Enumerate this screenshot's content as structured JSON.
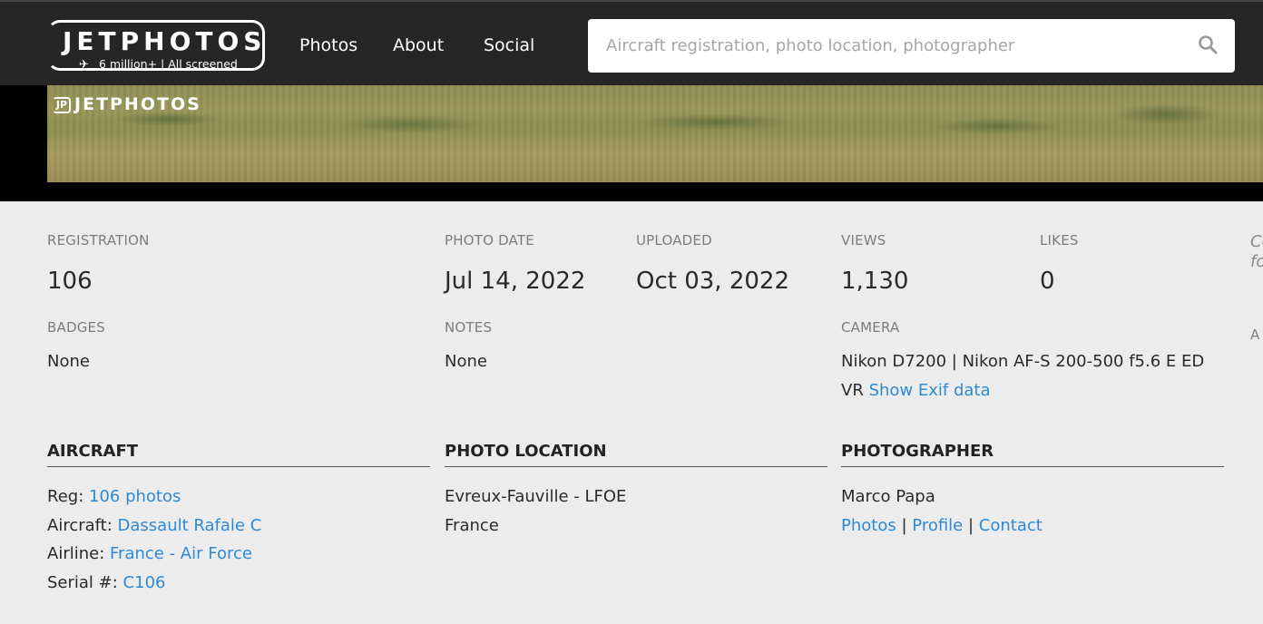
{
  "header": {
    "logo_text": "JETPHOTOS",
    "logo_subtitle": "6 million+ | All screened",
    "nav": [
      "Photos",
      "About",
      "Social"
    ],
    "search_placeholder": "Aircraft registration, photo location, photographer"
  },
  "photo": {
    "watermark": "JETPHOTOS"
  },
  "details": {
    "registration_label": "REGISTRATION",
    "registration": "106",
    "photo_date_label": "PHOTO DATE",
    "photo_date": "Jul 14, 2022",
    "uploaded_label": "UPLOADED",
    "uploaded": "Oct 03, 2022",
    "views_label": "VIEWS",
    "views": "1,130",
    "likes_label": "LIKES",
    "likes": "0",
    "badges_label": "BADGES",
    "badges": "None",
    "notes_label": "NOTES",
    "notes": "None",
    "camera_label": "CAMERA",
    "camera_line1": "Nikon D7200 | Nikon AF-S 200-500 f5.6 E ED",
    "camera_line2": "VR",
    "exif_link": "Show Exif data"
  },
  "aircraft": {
    "heading": "AIRCRAFT",
    "reg_label": "Reg:",
    "reg_link": "106 photos",
    "aircraft_label": "Aircraft:",
    "aircraft_link": "Dassault Rafale C",
    "airline_label": "Airline:",
    "airline_link": "France - Air Force",
    "serial_label": "Serial #:",
    "serial_link": "C106"
  },
  "location": {
    "heading": "PHOTO LOCATION",
    "airport": "Evreux-Fauville - LFOE",
    "country": "France"
  },
  "photographer": {
    "heading": "PHOTOGRAPHER",
    "name": "Marco Papa",
    "links": [
      "Photos",
      "Profile",
      "Contact"
    ],
    "separator": "|"
  },
  "right_edge": {
    "cut_text_1": "Co",
    "cut_text_2": "fo",
    "cut_label": "A"
  },
  "colors": {
    "header_bg": "#262626",
    "page_bg": "#ececec",
    "link": "#2d8ad8",
    "label": "#7d7d7d"
  }
}
